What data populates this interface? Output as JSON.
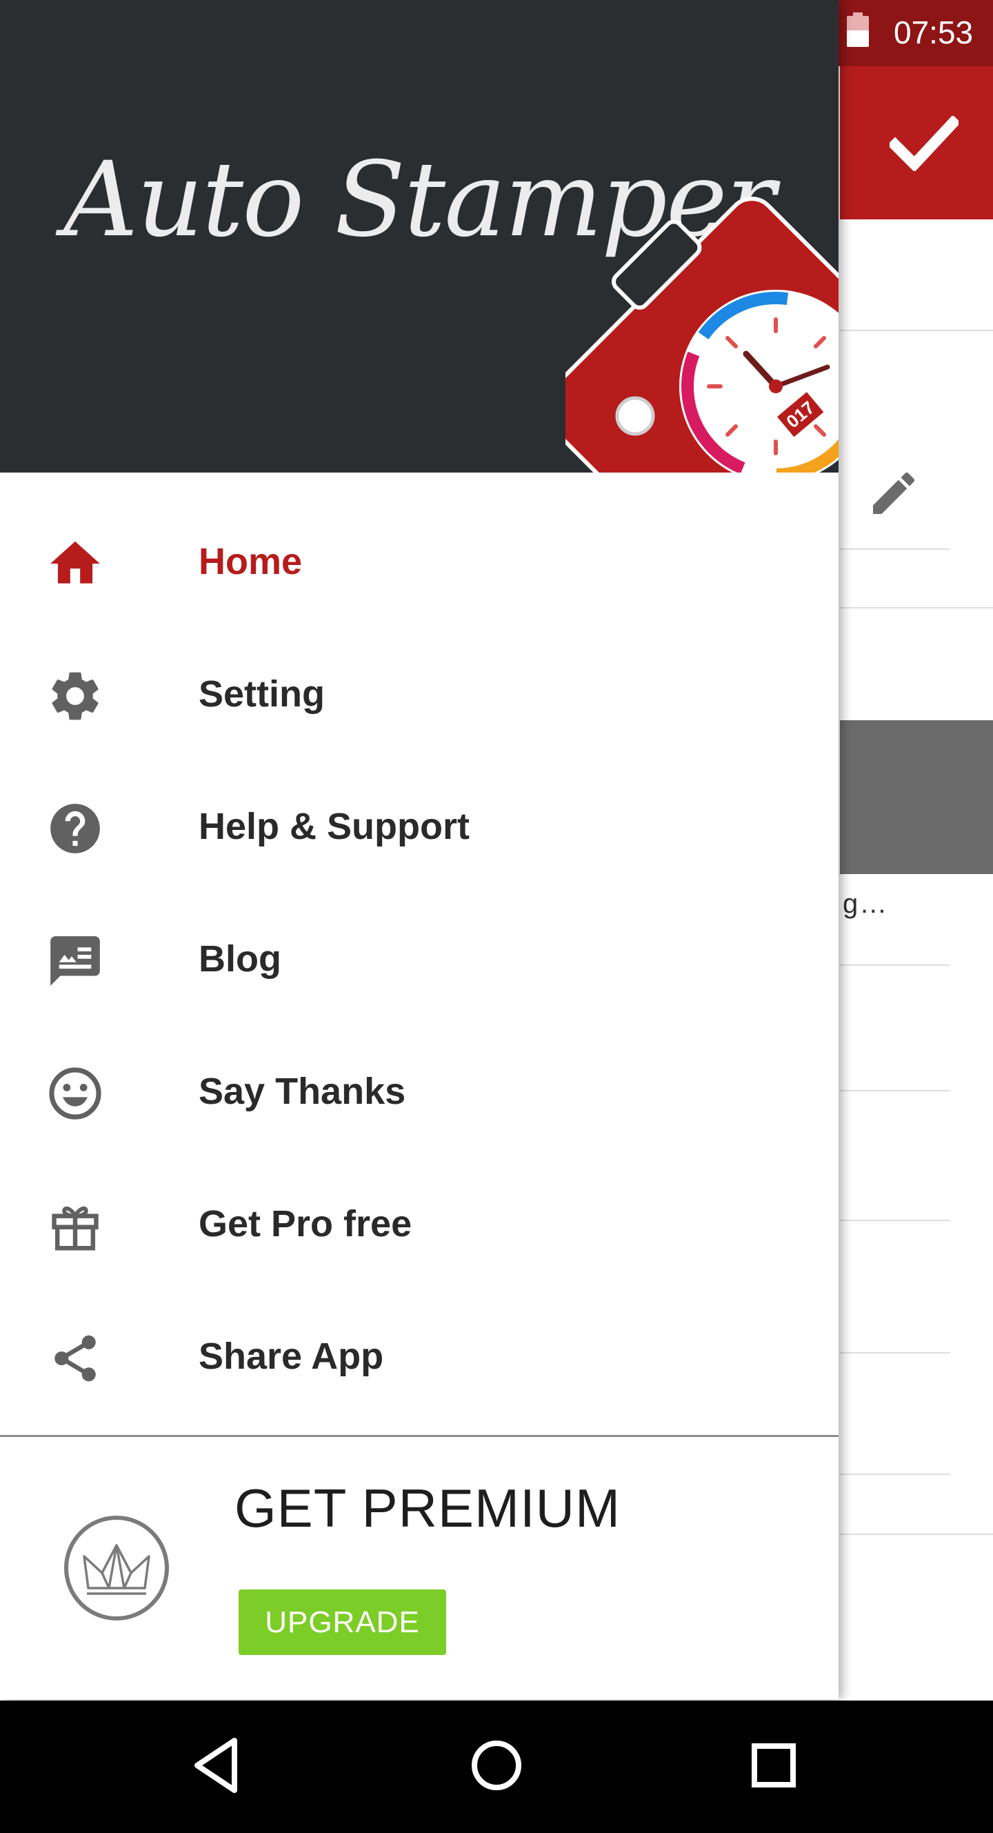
{
  "status_bar": {
    "time": "07:53"
  },
  "background": {
    "truncated_text": "g…"
  },
  "drawer": {
    "logo_text": "Auto Stamper",
    "stamp_date_text": "017",
    "menu": [
      {
        "label": "Home",
        "icon": "home-icon",
        "active": true
      },
      {
        "label": "Setting",
        "icon": "gear-icon"
      },
      {
        "label": "Help & Support",
        "icon": "help-icon"
      },
      {
        "label": "Blog",
        "icon": "blog-icon"
      },
      {
        "label": "Say Thanks",
        "icon": "smiley-icon"
      },
      {
        "label": "Get Pro free",
        "icon": "gift-icon"
      },
      {
        "label": "Share App",
        "icon": "share-icon"
      }
    ],
    "premium": {
      "title": "GET PREMIUM",
      "button_label": "UPGRADE",
      "icon": "crown-icon"
    }
  },
  "colors": {
    "accent": "#b71c1c",
    "header_bg": "#2b2e30",
    "upgrade_green": "#7ccd27",
    "menu_text": "#2a2a2a",
    "icon_gray": "#6b6b6b"
  }
}
